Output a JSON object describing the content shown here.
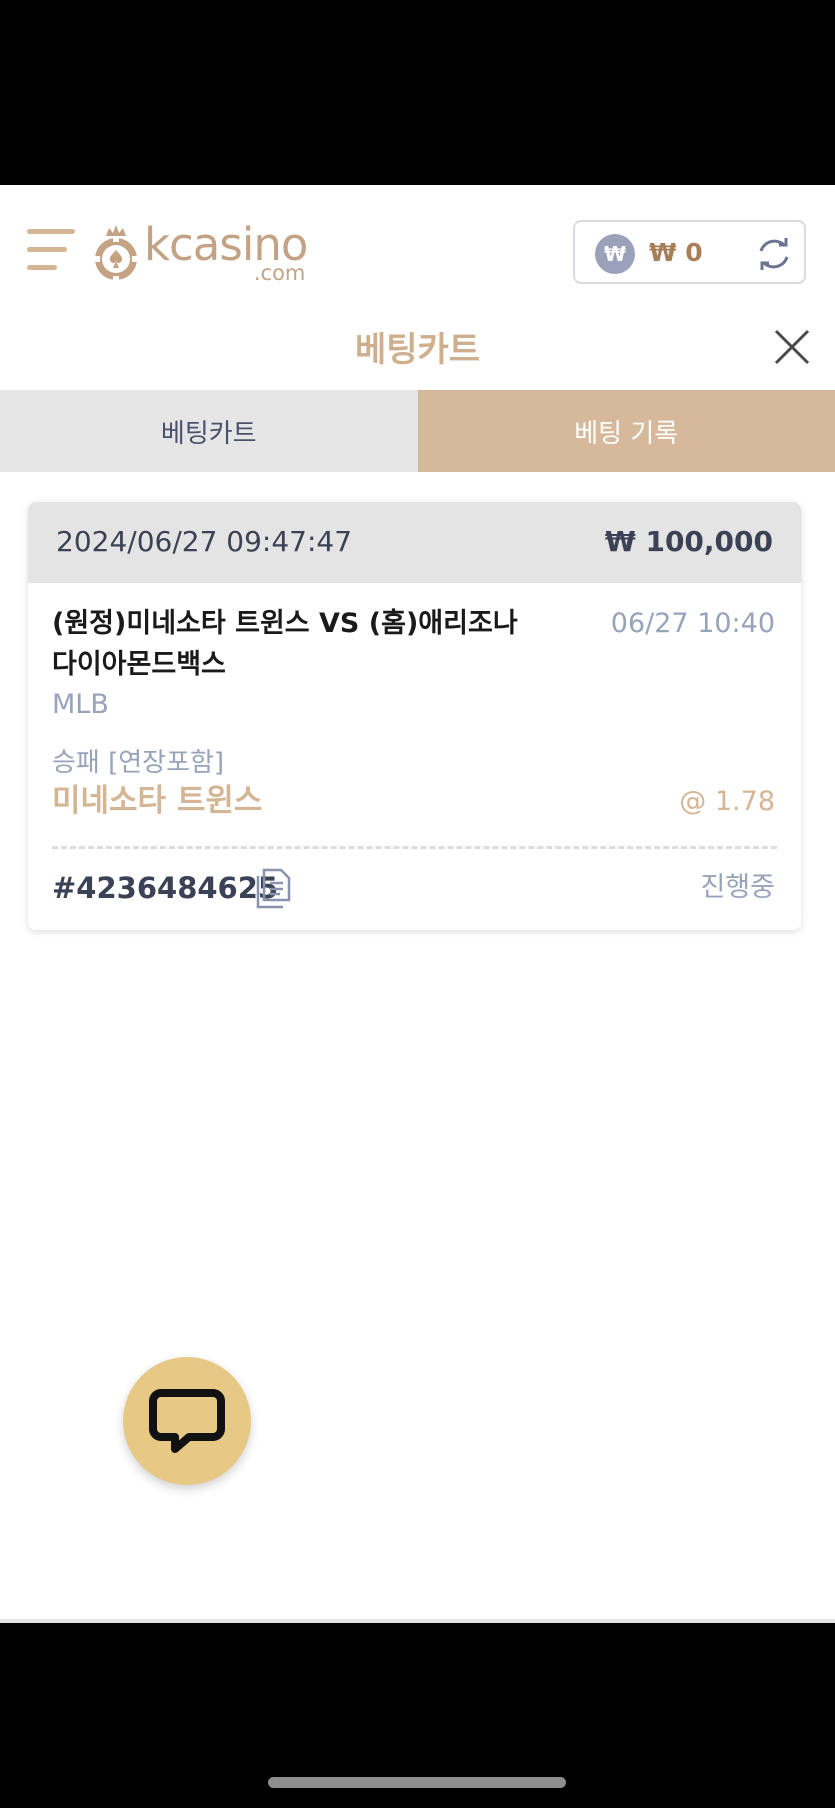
{
  "header": {
    "brand_name": "kcasino",
    "brand_domain": ".com",
    "currency_symbol": "₩",
    "balance": "₩ 0",
    "brand_color": "#c4a384"
  },
  "title": "베팅카트",
  "tabs": [
    {
      "label": "베팅카트",
      "active": false
    },
    {
      "label": "베팅 기록",
      "active": true
    }
  ],
  "bet": {
    "datetime": "2024/06/27 09:47:47",
    "stake": "₩ 100,000",
    "match": "(원정)미네소타 트윈스 VS (홈)애리조나 다이아몬드백스",
    "match_time": "06/27 10:40",
    "league": "MLB",
    "market": "승패 [연장포함]",
    "pick": "미네소타 트윈스",
    "odds": "@ 1.78",
    "ticket_id": "#4236484625",
    "status": "진행중"
  },
  "icons": {
    "menu": "menu-icon",
    "refresh": "refresh-icon",
    "close": "close-icon",
    "copy": "copy-icon",
    "chat": "chat-icon"
  },
  "colors": {
    "accent": "#d4b594",
    "tab_active_bg": "#d5b99a",
    "tab_inactive_bg": "#e6e6e6",
    "muted_text": "#97a2bb",
    "chat_fab": "#e7c985"
  }
}
